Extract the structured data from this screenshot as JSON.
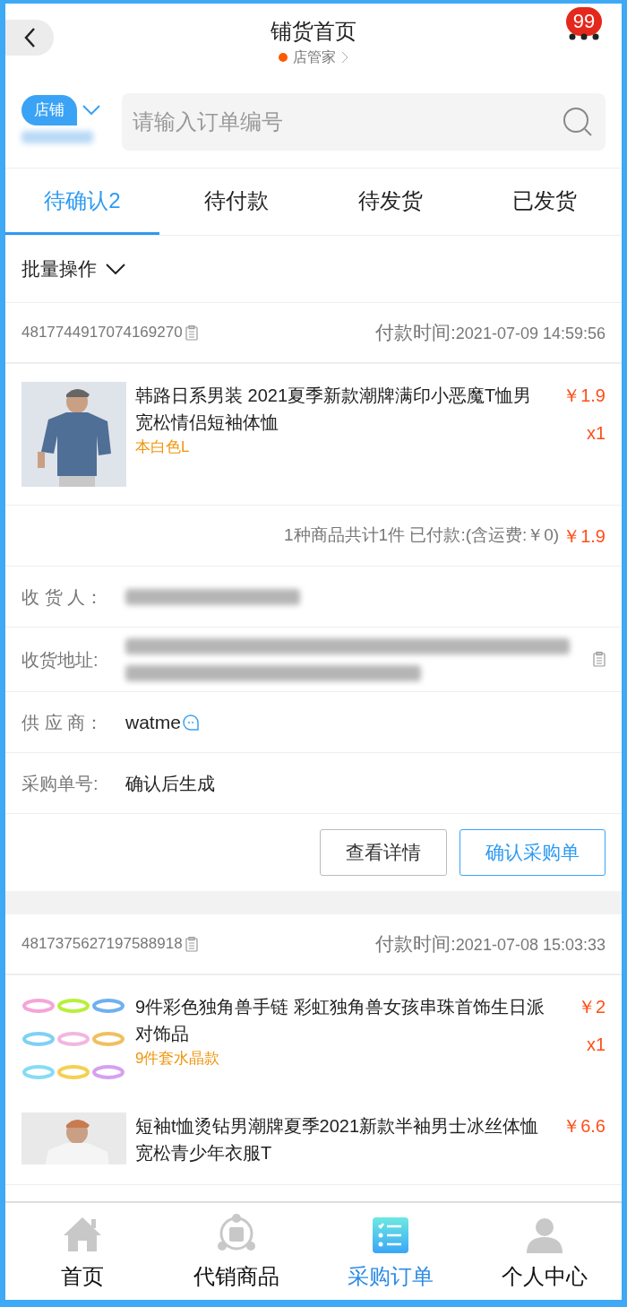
{
  "header": {
    "title": "铺货首页",
    "subtitle": "店管家",
    "badge": "99"
  },
  "search": {
    "store_tag": "店铺",
    "placeholder": "请输入订单编号"
  },
  "tabs": [
    {
      "label": "待确认2",
      "selected": true
    },
    {
      "label": "待付款",
      "selected": false
    },
    {
      "label": "待发货",
      "selected": false
    },
    {
      "label": "已发货",
      "selected": false
    }
  ],
  "batch": "批量操作",
  "orders": [
    {
      "number": "4817744917074169270",
      "pay_time_label": "付款时间:",
      "pay_time": "2021-07-09 14:59:56",
      "items": [
        {
          "title": "韩路日系男装 2021夏季新款潮牌满印小恶魔T恤男宽松情侣短袖体恤",
          "variant": "本白色L",
          "price": "￥1.9",
          "qty": "x1",
          "kind": "shirt"
        }
      ],
      "summary": "1种商品共计1件 已付款:(含运费:￥0)",
      "total": "￥1.9",
      "fields": [
        {
          "label": "收 货 人：",
          "kind": "blurred"
        },
        {
          "label": "收货地址:",
          "kind": "blurred_address"
        },
        {
          "label": "供 应 商：",
          "value": "watme",
          "kind": "supplier"
        },
        {
          "label": "采购单号:",
          "value": "确认后生成",
          "kind": "text"
        }
      ],
      "buttons": [
        {
          "label": "查看详情",
          "primary": false
        },
        {
          "label": "确认采购单",
          "primary": true
        }
      ]
    },
    {
      "number": "4817375627197588918",
      "pay_time_label": "付款时间:",
      "pay_time": "2021-07-08 15:03:33",
      "items": [
        {
          "title": "9件彩色独角兽手链  彩虹独角兽女孩串珠首饰生日派对饰品",
          "variant": "9件套水晶款",
          "price": "￥2",
          "qty": "x1",
          "kind": "bracelets"
        },
        {
          "title": "短袖t恤烫钻男潮牌夏季2021新款半袖男士冰丝体恤宽松青少年衣服T",
          "price": "￥6.6",
          "kind": "tee"
        }
      ]
    }
  ],
  "nav": [
    {
      "label": "首页",
      "selected": false,
      "kind": "home"
    },
    {
      "label": "代销商品",
      "selected": false,
      "kind": "share"
    },
    {
      "label": "采购订单",
      "selected": true,
      "kind": "list"
    },
    {
      "label": "个人中心",
      "selected": false,
      "kind": "user"
    }
  ]
}
